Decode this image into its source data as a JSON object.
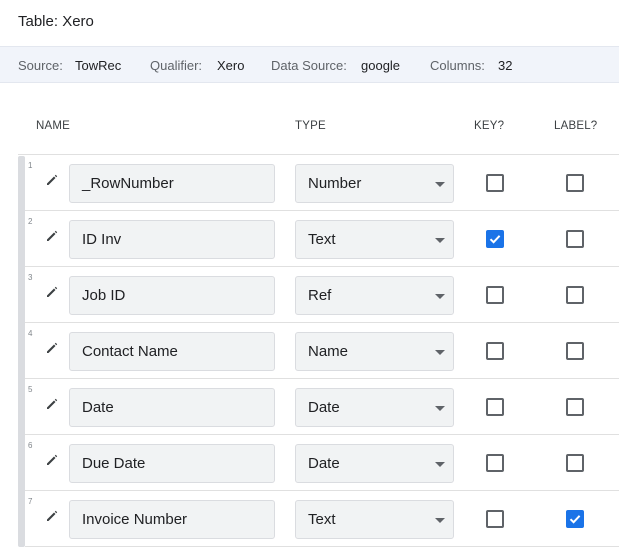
{
  "title": "Table: Xero",
  "meta": {
    "source_label": "Source:",
    "source_value": "TowRec",
    "qualifier_label": "Qualifier:",
    "qualifier_value": "Xero",
    "datasource_label": "Data Source:",
    "datasource_value": "google",
    "columns_label": "Columns:",
    "columns_value": "32"
  },
  "headers": {
    "name": "NAME",
    "type": "TYPE",
    "key": "KEY?",
    "label": "LABEL?"
  },
  "rows": [
    {
      "num": "1",
      "name": "_RowNumber",
      "type": "Number",
      "key": false,
      "label": false
    },
    {
      "num": "2",
      "name": "ID Inv",
      "type": "Text",
      "key": true,
      "label": false
    },
    {
      "num": "3",
      "name": "Job ID",
      "type": "Ref",
      "key": false,
      "label": false
    },
    {
      "num": "4",
      "name": "Contact Name",
      "type": "Name",
      "key": false,
      "label": false
    },
    {
      "num": "5",
      "name": "Date",
      "type": "Date",
      "key": false,
      "label": false
    },
    {
      "num": "6",
      "name": "Due Date",
      "type": "Date",
      "key": false,
      "label": false
    },
    {
      "num": "7",
      "name": "Invoice Number",
      "type": "Text",
      "key": false,
      "label": true
    }
  ],
  "colors": {
    "accent": "#1a73e8",
    "field_bg": "#f1f3f4",
    "meta_bg": "#f1f4fa"
  },
  "icons": {
    "edit": "pencil-icon",
    "dropdown": "caret-down-icon",
    "checkbox": "checkbox-icon"
  }
}
